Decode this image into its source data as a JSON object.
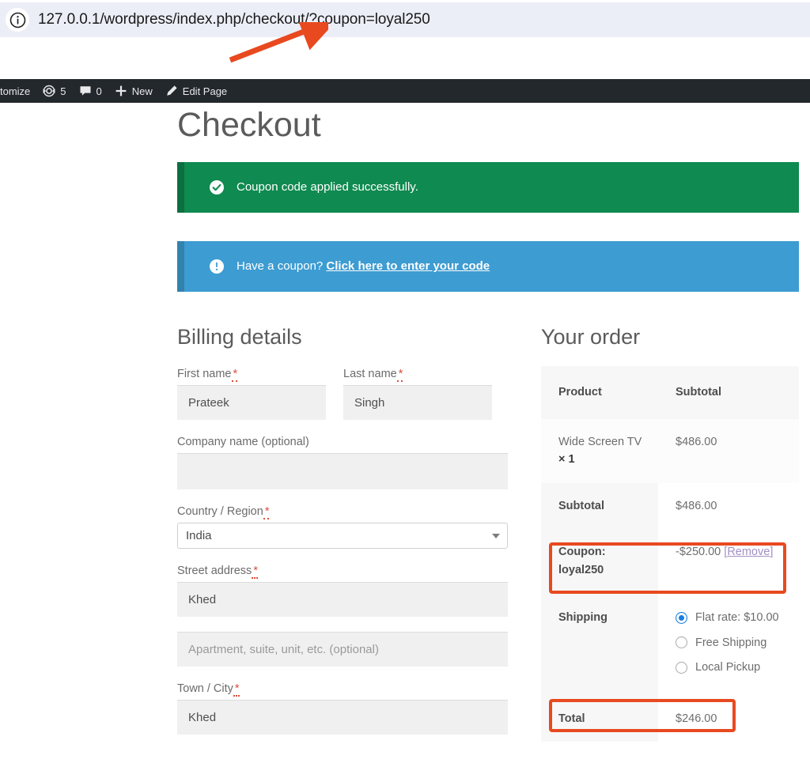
{
  "browser": {
    "info_icon": "info-circle-icon",
    "url": "127.0.0.1/wordpress/index.php/checkout/?coupon=loyal250"
  },
  "annotations": {
    "arrow_color": "#e8491f",
    "highlight_color": "#e8491f",
    "arrow_points_to": "?coupon=loyal250",
    "highlighted_rows": [
      "Coupon: loyal250",
      "Total"
    ]
  },
  "admin_bar": {
    "items": [
      {
        "label": "tomize",
        "icon": null
      },
      {
        "label": "5",
        "icon": "updates-icon"
      },
      {
        "label": "0",
        "icon": "comment-icon"
      },
      {
        "label": "New",
        "icon": "plus-icon"
      },
      {
        "label": "Edit Page",
        "icon": "pencil-icon"
      }
    ]
  },
  "page": {
    "title": "Checkout"
  },
  "notices": {
    "success": {
      "icon": "check-circle-icon",
      "text": "Coupon code applied successfully.",
      "bg": "#0f8a50"
    },
    "coupon": {
      "icon": "exclamation-circle-icon",
      "prefix": "Have a coupon?",
      "link": "Click here to enter your code",
      "bg": "#3d9cd2"
    }
  },
  "billing": {
    "heading": "Billing details",
    "first_name": {
      "label": "First name",
      "required": "*",
      "value": "Prateek"
    },
    "last_name": {
      "label": "Last name",
      "required": "*",
      "value": "Singh"
    },
    "company": {
      "label": "Company name (optional)",
      "value": ""
    },
    "country": {
      "label": "Country / Region",
      "required": "*",
      "value": "India"
    },
    "street": {
      "label": "Street address",
      "required": "*",
      "value": "Khed"
    },
    "apartment": {
      "placeholder": "Apartment, suite, unit, etc. (optional)",
      "value": ""
    },
    "city": {
      "label": "Town / City",
      "required": "*",
      "value": "Khed"
    }
  },
  "order": {
    "heading": "Your order",
    "columns": [
      "Product",
      "Subtotal"
    ],
    "product": {
      "name": "Wide Screen TV",
      "qty": "× 1",
      "subtotal": "$486.00"
    },
    "subtotal": {
      "label": "Subtotal",
      "value": "$486.00"
    },
    "coupon": {
      "label": "Coupon:",
      "code": "loyal250",
      "amount": "-$250.00",
      "remove_open": "[",
      "remove": "Remove",
      "remove_close": "]"
    },
    "shipping": {
      "label": "Shipping",
      "options": [
        {
          "label": "Flat rate: $10.00",
          "selected": true
        },
        {
          "label": "Free Shipping",
          "selected": false
        },
        {
          "label": "Local Pickup",
          "selected": false
        }
      ]
    },
    "total": {
      "label": "Total",
      "value": "$246.00"
    }
  }
}
